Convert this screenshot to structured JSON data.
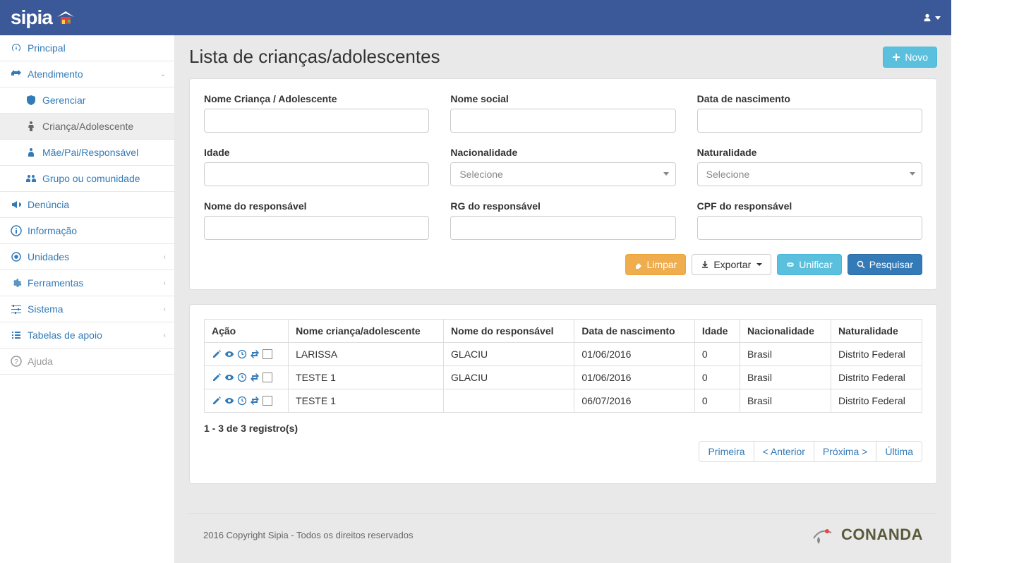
{
  "brand": "sipia",
  "page": {
    "title": "Lista de crianças/adolescentes"
  },
  "buttons": {
    "novo": "Novo",
    "limpar": "Limpar",
    "exportar": "Exportar",
    "unificar": "Unificar",
    "pesquisar": "Pesquisar"
  },
  "sidebar": {
    "principal": "Principal",
    "atendimento": "Atendimento",
    "gerenciar": "Gerenciar",
    "crianca": "Criança/Adolescente",
    "responsavel": "Mãe/Pai/Responsável",
    "grupo": "Grupo ou comunidade",
    "denuncia": "Denúncia",
    "informacao": "Informação",
    "unidades": "Unidades",
    "ferramentas": "Ferramentas",
    "sistema": "Sistema",
    "tabelas": "Tabelas de apoio",
    "ajuda": "Ajuda"
  },
  "filters": {
    "nome_crianca": "Nome Criança / Adolescente",
    "nome_social": "Nome social",
    "data_nascimento": "Data de nascimento",
    "idade": "Idade",
    "nacionalidade": "Nacionalidade",
    "naturalidade": "Naturalidade",
    "nome_responsavel": "Nome do responsável",
    "rg_responsavel": "RG do responsável",
    "cpf_responsavel": "CPF do responsável",
    "selecione": "Selecione"
  },
  "table": {
    "headers": {
      "acao": "Ação",
      "nome_crianca": "Nome criança/adolescente",
      "nome_responsavel": "Nome do responsável",
      "data_nascimento": "Data de nascimento",
      "idade": "Idade",
      "nacionalidade": "Nacionalidade",
      "naturalidade": "Naturalidade"
    },
    "rows": [
      {
        "nome": "LARISSA",
        "responsavel": "GLACIU",
        "data": "01/06/2016",
        "idade": "0",
        "nacionalidade": "Brasil",
        "naturalidade": "Distrito Federal"
      },
      {
        "nome": "TESTE 1",
        "responsavel": "GLACIU",
        "data": "01/06/2016",
        "idade": "0",
        "nacionalidade": "Brasil",
        "naturalidade": "Distrito Federal"
      },
      {
        "nome": "TESTE 1",
        "responsavel": "",
        "data": "06/07/2016",
        "idade": "0",
        "nacionalidade": "Brasil",
        "naturalidade": "Distrito Federal"
      }
    ]
  },
  "records_info": "1 - 3 de 3 registro(s)",
  "pagination": {
    "first": "Primeira",
    "prev": "< Anterior",
    "next": "Próxima >",
    "last": "Última"
  },
  "footer": {
    "copyright": "2016 Copyright Sipia - Todos os direitos reservados",
    "logo": "CONANDA"
  }
}
